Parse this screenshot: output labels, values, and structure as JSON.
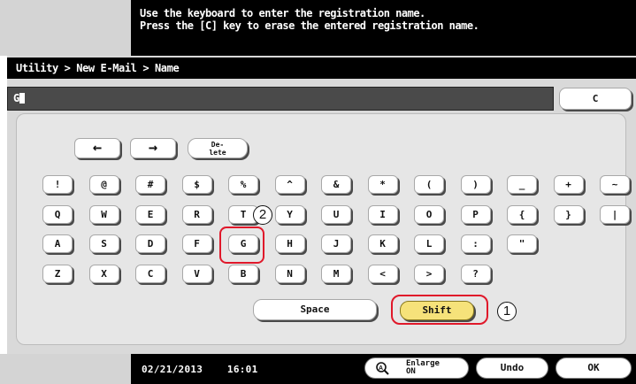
{
  "message": {
    "line1": "Use the keyboard to enter the registration name.",
    "line2": "Press the [C] key to erase the entered registration name."
  },
  "breadcrumb": "Utility > New E-Mail > Name",
  "name_field": {
    "value": "G"
  },
  "clear_key": "C",
  "nav": {
    "left": "←",
    "right": "→",
    "delete_line1": "De-",
    "delete_line2": "lete"
  },
  "rows": [
    [
      "!",
      "@",
      "#",
      "$",
      "%",
      "^",
      "&",
      "*",
      "(",
      ")",
      "_",
      "+",
      "~"
    ],
    [
      "Q",
      "W",
      "E",
      "R",
      "T",
      "Y",
      "U",
      "I",
      "O",
      "P",
      "{",
      "}",
      "|"
    ],
    [
      "A",
      "S",
      "D",
      "F",
      "G",
      "H",
      "J",
      "K",
      "L",
      ":",
      "\""
    ],
    [
      "Z",
      "X",
      "C",
      "V",
      "B",
      "N",
      "M",
      "<",
      ">",
      "?"
    ]
  ],
  "space_label": "Space",
  "shift_label": "Shift",
  "callouts": {
    "one": "1",
    "two": "2"
  },
  "footer": {
    "datetime": "02/21/2013    16:01",
    "enlarge_line1": "Enlarge",
    "enlarge_line2": "ON",
    "undo": "Undo",
    "ok": "OK"
  },
  "colors": {
    "highlight": "#e0182a",
    "shift_active": "#f6e27a"
  }
}
